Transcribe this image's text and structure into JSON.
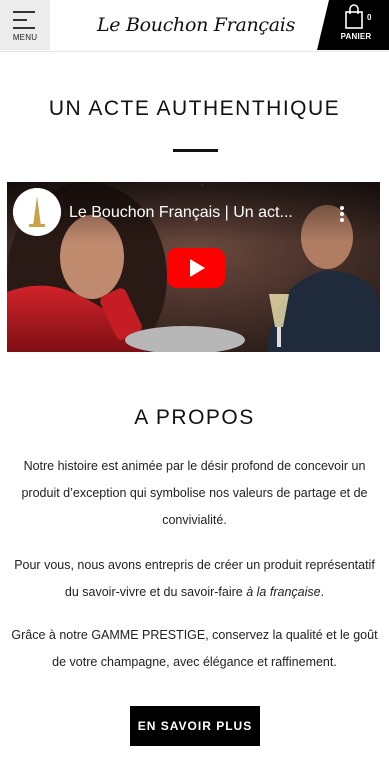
{
  "header": {
    "menu_label": "MENU",
    "logo_text": "Le Bouchon Français",
    "cart_label": "PANIER",
    "cart_count": "0"
  },
  "section1": {
    "title": "UN ACTE AUTHENTHIQUE"
  },
  "video": {
    "title": "Le Bouchon Français | Un act..."
  },
  "about": {
    "title": "A PROPOS",
    "para1": "Notre histoire est animée par le désir profond de concevoir un produit d’exception qui symbolise nos valeurs de partage et de convivialité.",
    "para2_main": "Pour vous, nous avons entrepris de créer un produit représentatif du savoir-vivre et du savoir-faire ",
    "para2_italic": "à la française",
    "para2_end": ".",
    "para3": "Grâce à notre GAMME PRESTIGE, conservez la qualité et le goût de votre champagne, avec élégance et raffinement.",
    "cta_label": "EN SAVOIR PLUS"
  },
  "colors": {
    "primary": "#000000",
    "header_menu_bg": "#ececec",
    "youtube_red": "#ff0000"
  }
}
